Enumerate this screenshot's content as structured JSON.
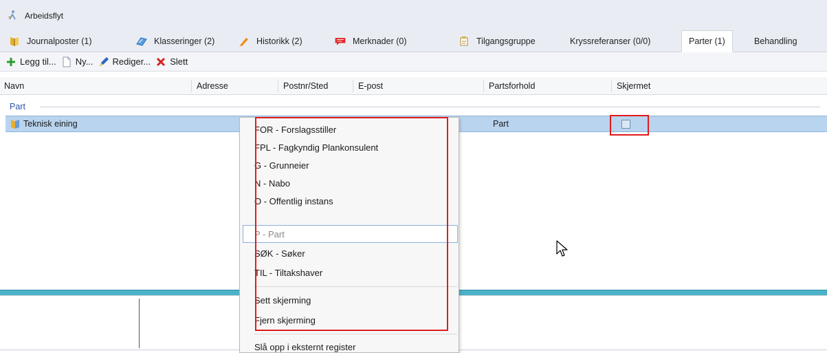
{
  "workflow": {
    "label": "Arbeidsflyt",
    "icon": "workflow-icon"
  },
  "tabs": [
    {
      "label": "Journalposter (1)",
      "icon": "journal-icon"
    },
    {
      "label": "Klasseringer (2)",
      "icon": "classification-icon"
    },
    {
      "label": "Historikk (2)",
      "icon": "history-icon"
    },
    {
      "label": "Merknader (0)",
      "icon": "comment-icon"
    },
    {
      "label": "Tilgangsgruppe",
      "icon": "access-group-icon"
    },
    {
      "label": "Kryssreferanser (0/0)"
    },
    {
      "label": "Parter (1)",
      "active": true
    },
    {
      "label": "Behandling"
    }
  ],
  "toolbar": {
    "add_label": "Legg til...",
    "new_label": "Ny...",
    "edit_label": "Rediger...",
    "delete_label": "Slett"
  },
  "columns": [
    "Navn",
    "Adresse",
    "Postnr/Sted",
    "E-post",
    "Partsforhold",
    "Skjermet"
  ],
  "group": {
    "label": "Part"
  },
  "row": {
    "name": "Teknisk eining",
    "partsforhold": "Part",
    "skjermet": false
  },
  "context_menu": {
    "items": [
      {
        "label": "FOR - Forslagsstiller"
      },
      {
        "label": "FPL - Fagkyndig Plankonsulent"
      },
      {
        "label": "G - Grunneier"
      },
      {
        "label": "N - Nabo"
      },
      {
        "label": "O - Offentlig instans"
      },
      {
        "label": "P - Part",
        "disabled": true
      },
      {
        "label": "SØK - Søker"
      },
      {
        "label": "TIL - Tiltakshaver"
      }
    ],
    "actions": [
      {
        "label": "Sett skjerming"
      },
      {
        "label": "Fjern skjerming"
      }
    ],
    "extra": [
      {
        "label": "Slå opp i eksternt register"
      }
    ]
  },
  "colors": {
    "highlight": "#e01b1b",
    "selection": "#b9d4ee",
    "accent_bar": "#4bb2c8"
  }
}
